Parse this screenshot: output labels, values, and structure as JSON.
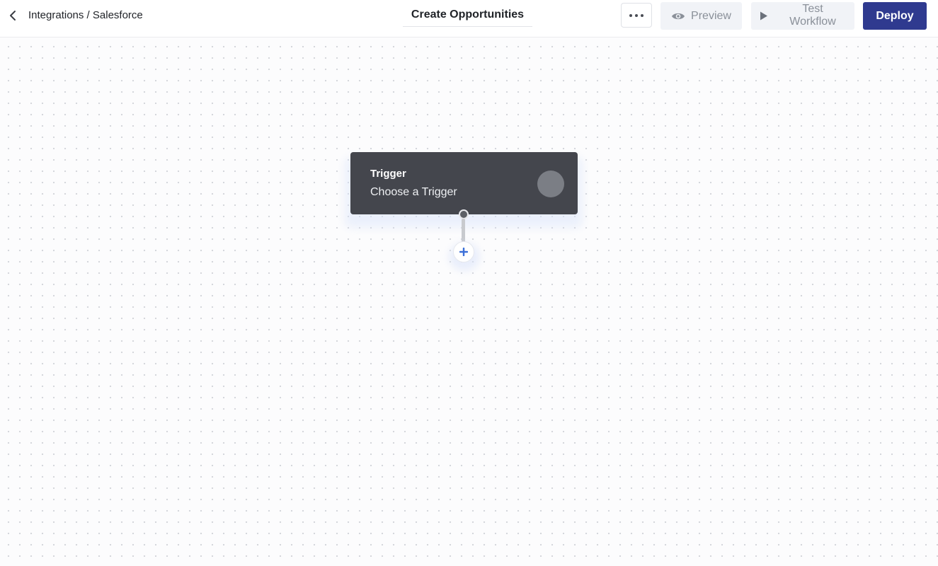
{
  "header": {
    "breadcrumb": "Integrations / Salesforce",
    "workflow_title": "Create Opportunities",
    "preview_label": "Preview",
    "test_label_line1": "Test",
    "test_label_line2": "Workflow",
    "deploy_label": "Deploy",
    "icons": {
      "back": "chevron-left-icon",
      "more": "more-horizontal-icon",
      "preview": "eye-icon",
      "test": "play-icon"
    }
  },
  "canvas": {
    "trigger_node": {
      "title": "Trigger",
      "subtitle": "Choose a Trigger"
    },
    "add_step_icon": "plus-icon"
  },
  "colors": {
    "deploy_bg": "#2f3a8f",
    "node_bg": "#44464d",
    "add_icon": "#3b6fd8"
  }
}
